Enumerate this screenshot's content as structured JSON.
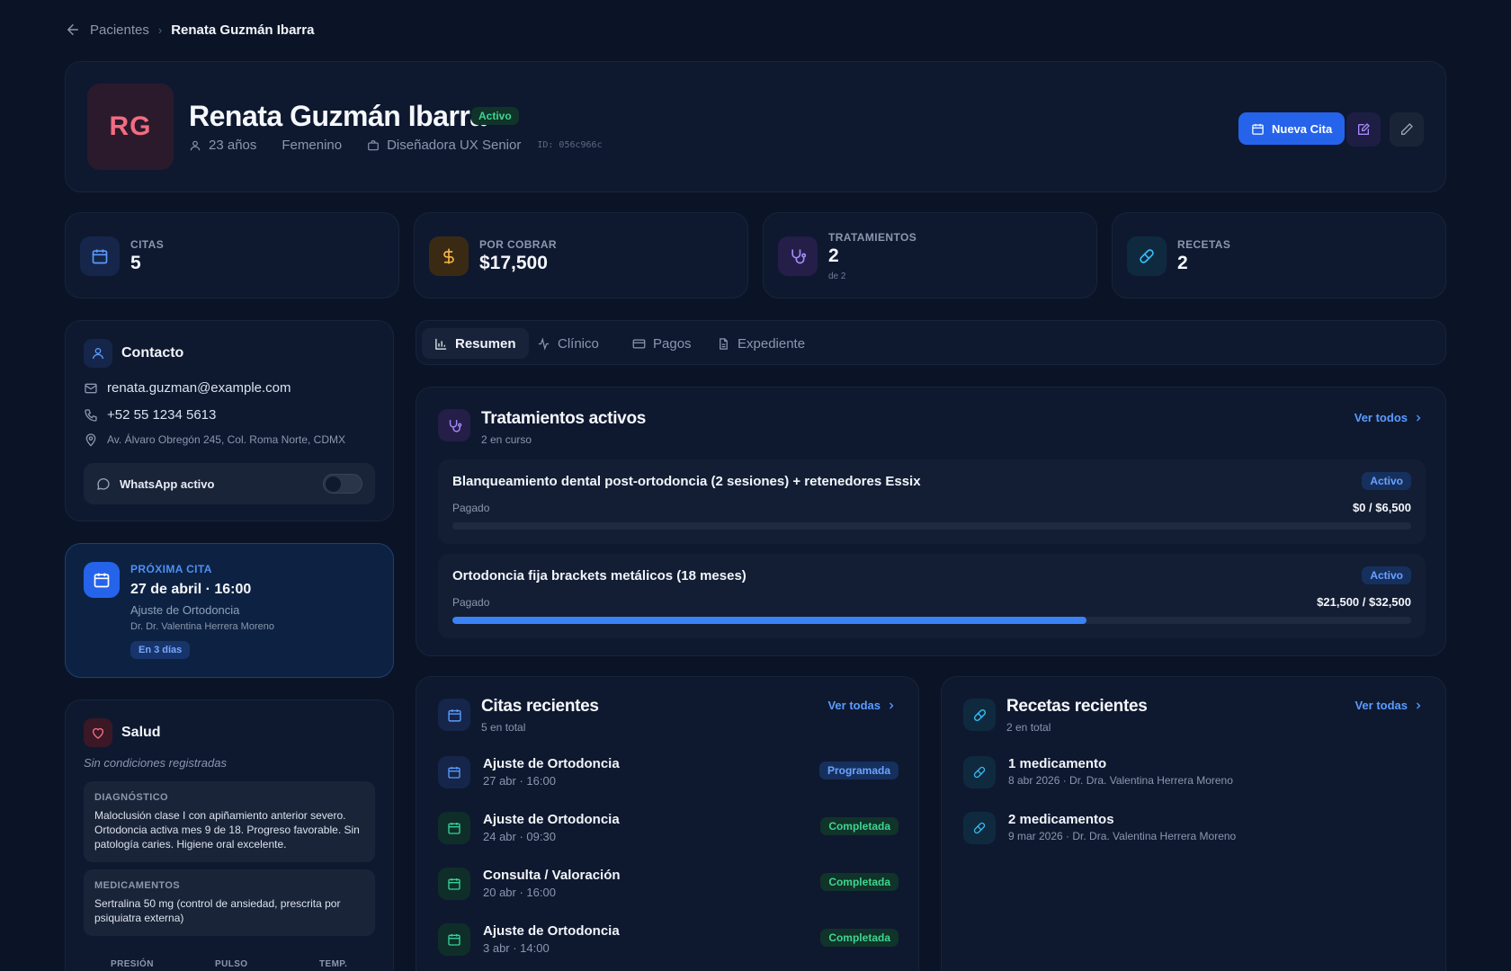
{
  "breadcrumb": {
    "parent": "Pacientes",
    "current": "Renata Guzmán Ibarra"
  },
  "patient": {
    "initials": "RG",
    "name": "Renata Guzmán Ibarra",
    "status": "Activo",
    "age": "23 años",
    "gender": "Femenino",
    "occupation": "Diseñadora UX Senior",
    "id_label": "ID: 056c966c"
  },
  "header_actions": {
    "new_appointment": "Nueva Cita"
  },
  "stats": [
    {
      "label": "CITAS",
      "value": "5",
      "sub": "",
      "icon": "calendar-icon"
    },
    {
      "label": "POR COBRAR",
      "value": "$17,500",
      "sub": "",
      "icon": "dollar-icon"
    },
    {
      "label": "TRATAMIENTOS",
      "value": "2",
      "sub": "de 2",
      "icon": "stethoscope-icon"
    },
    {
      "label": "RECETAS",
      "value": "2",
      "sub": "",
      "icon": "pill-icon"
    }
  ],
  "contact": {
    "title": "Contacto",
    "email": "renata.guzman@example.com",
    "phone": "+52 55 1234 5613",
    "address": "Av. Álvaro Obregón 245, Col. Roma Norte, CDMX",
    "whatsapp_label": "WhatsApp activo",
    "whatsapp_enabled": false
  },
  "next_appointment": {
    "label": "PRÓXIMA CITA",
    "date": "27 de abril · 16:00",
    "type": "Ajuste de Ortodoncia",
    "doctor": "Dr. Dr. Valentina Herrera Moreno",
    "badge": "En 3 días"
  },
  "health": {
    "title": "Salud",
    "conditions": "Sin condiciones registradas",
    "diagnosis_label": "DIAGNÓSTICO",
    "diagnosis": "Maloclusión clase I con apiñamiento anterior severo. Ortodoncia activa mes 9 de 18. Progreso favorable. Sin patología caries. Higiene oral excelente.",
    "medications_label": "MEDICAMENTOS",
    "medications": "Sertralina 50 mg (control de ansiedad, prescrita por psiquiatra externa)",
    "vitals": [
      "PRESIÓN",
      "PULSO",
      "TEMP."
    ]
  },
  "tabs": [
    {
      "label": "Resumen",
      "active": true
    },
    {
      "label": "Clínico",
      "active": false
    },
    {
      "label": "Pagos",
      "active": false
    },
    {
      "label": "Expediente",
      "active": false
    }
  ],
  "treatments": {
    "title": "Tratamientos activos",
    "subtitle": "2 en curso",
    "see_all": "Ver todos",
    "items": [
      {
        "name": "Blanqueamiento dental post-ortodoncia (2 sesiones) + retenedores Essix",
        "status": "Activo",
        "paid_label": "Pagado",
        "amount": "$0 / $6,500",
        "paid": 0,
        "total": 6500
      },
      {
        "name": "Ortodoncia fija brackets metálicos (18 meses)",
        "status": "Activo",
        "paid_label": "Pagado",
        "amount": "$21,500 / $32,500",
        "paid": 21500,
        "total": 32500
      }
    ]
  },
  "appointments": {
    "title": "Citas recientes",
    "subtitle": "5 en total",
    "see_all": "Ver todas",
    "items": [
      {
        "title": "Ajuste de Ortodoncia",
        "date": "27 abr · 16:00",
        "status": "Programada",
        "kind": "prog"
      },
      {
        "title": "Ajuste de Ortodoncia",
        "date": "24 abr · 09:30",
        "status": "Completada",
        "kind": "done"
      },
      {
        "title": "Consulta / Valoración",
        "date": "20 abr · 16:00",
        "status": "Completada",
        "kind": "done"
      },
      {
        "title": "Ajuste de Ortodoncia",
        "date": "3 abr · 14:00",
        "status": "Completada",
        "kind": "done"
      }
    ]
  },
  "prescriptions": {
    "title": "Recetas recientes",
    "subtitle": "2 en total",
    "see_all": "Ver todas",
    "items": [
      {
        "title": "1 medicamento",
        "meta": "8 abr 2026 · Dr. Dra. Valentina Herrera Moreno"
      },
      {
        "title": "2 medicamentos",
        "meta": "9 mar 2026 · Dr. Dra. Valentina Herrera Moreno"
      }
    ]
  },
  "colors": {
    "background": "#0b1426",
    "card": "#0e1930",
    "accent": "#2563eb",
    "success": "#3fd68f",
    "avatar": "#f26d82"
  }
}
